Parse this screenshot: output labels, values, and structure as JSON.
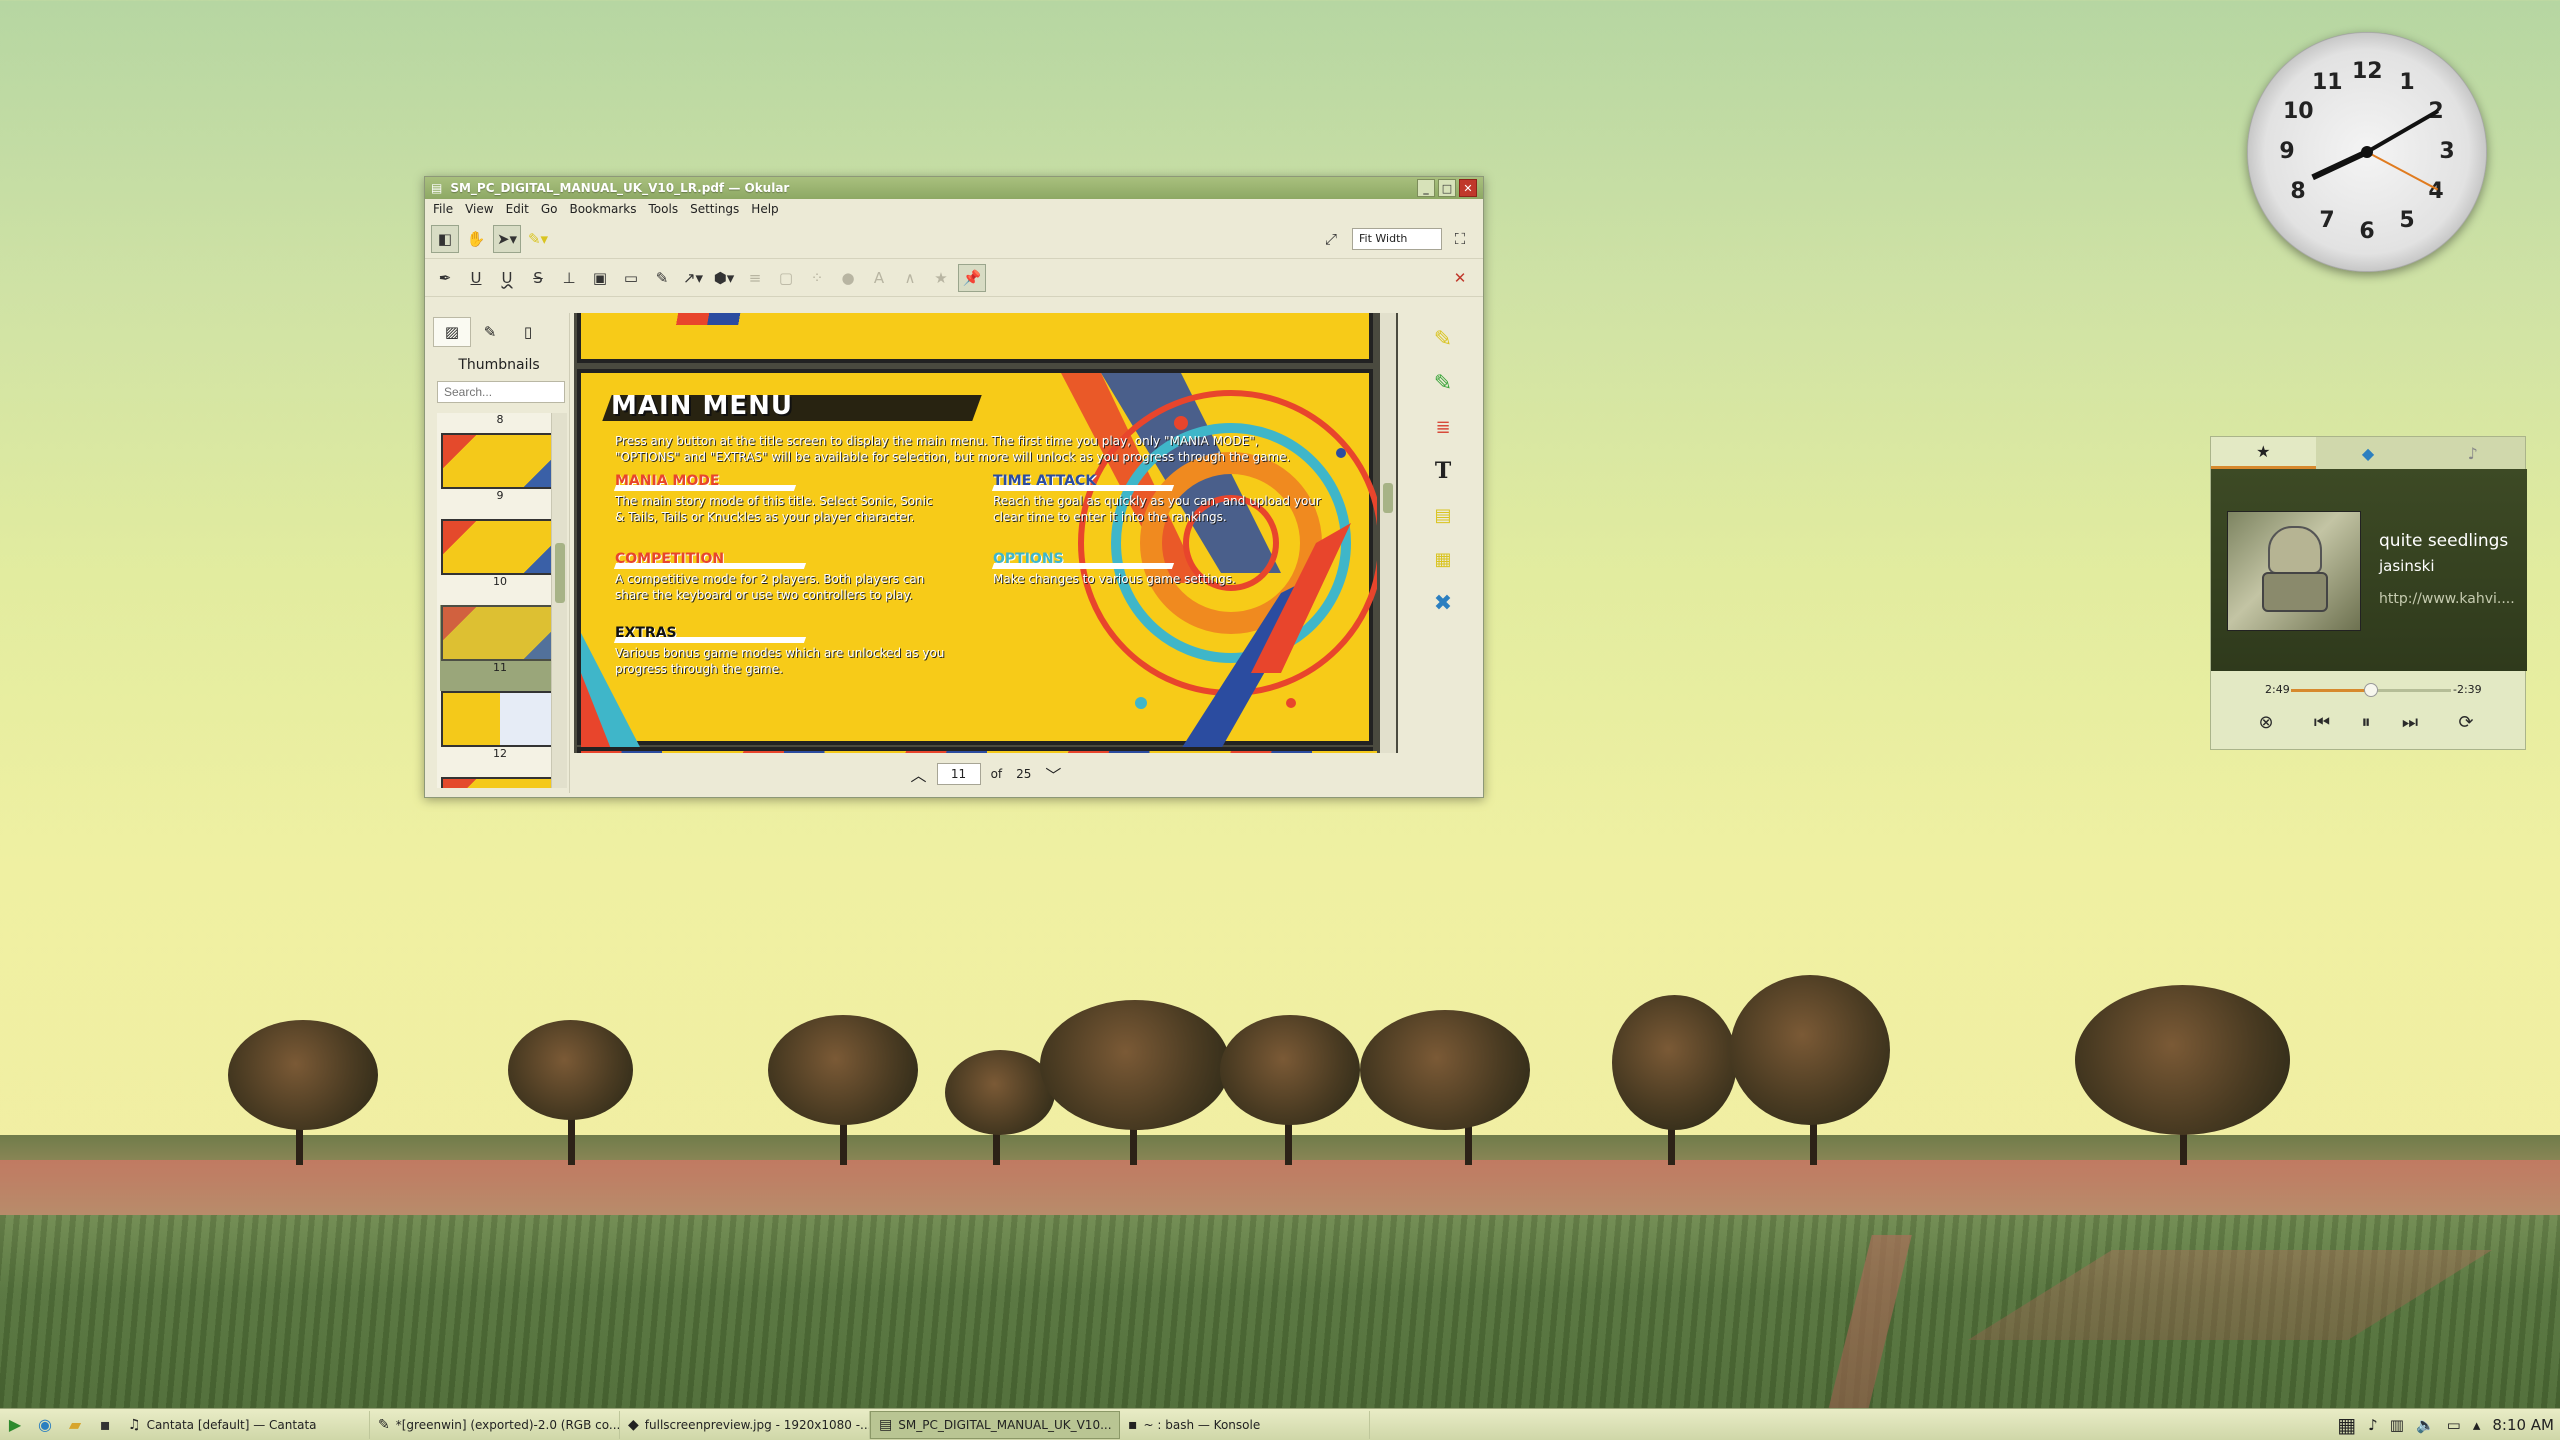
{
  "window": {
    "title": "SM_PC_DIGITAL_MANUAL_UK_V10_LR.pdf — Okular",
    "controls": {
      "minimize": "_",
      "maximize": "□",
      "close": "✕"
    },
    "menu": [
      "File",
      "View",
      "Edit",
      "Go",
      "Bookmarks",
      "Tools",
      "Settings",
      "Help"
    ],
    "zoom_value": "Fit Width",
    "sidebar": {
      "title": "Thumbnails",
      "search_placeholder": "Search...",
      "thumbnails": [
        {
          "label": "8",
          "selected": false
        },
        {
          "label": "9",
          "selected": false
        },
        {
          "label": "10",
          "selected": false
        },
        {
          "label": "11",
          "selected": true
        },
        {
          "label": "12",
          "selected": false
        }
      ]
    },
    "page_nav": {
      "current": "11",
      "of_label": "of",
      "total": "25"
    }
  },
  "document": {
    "heading": "MAIN MENU",
    "intro": "Press any button at the title screen to display the main menu. The first time you play, only \"MANIA MODE\", \"OPTIONS\" and \"EXTRAS\" will be available for selection, but more will unlock as you progress through the game.",
    "sections": [
      {
        "title": "MANIA MODE",
        "body": "The main story mode of this title. Select Sonic, Sonic & Tails, Tails or Knuckles as your player character.",
        "color": "#e8452c"
      },
      {
        "title": "TIME ATTACK",
        "body": "Reach the goal as quickly as you can, and upload your clear time to enter it into the rankings.",
        "color": "#2b4ca0"
      },
      {
        "title": "COMPETITION",
        "body": "A competitive mode for 2 players. Both players can share the keyboard or use two controllers to play.",
        "color": "#e8452c"
      },
      {
        "title": "OPTIONS",
        "body": "Make changes to various game settings.",
        "color": "#3fb6c9"
      },
      {
        "title": "EXTRAS",
        "body": "Various bonus game modes which are unlocked as you progress through the game.",
        "color": "#111111"
      }
    ]
  },
  "clock_widget": {
    "numbers": [
      "12",
      "1",
      "2",
      "3",
      "4",
      "5",
      "6",
      "7",
      "8",
      "9",
      "10",
      "11"
    ]
  },
  "player": {
    "track": "quite seedlings",
    "artist": "jasinski",
    "url": "http://www.kahvi....",
    "elapsed": "2:49",
    "remaining": "-2:39",
    "progress": 0.5
  },
  "taskbar": {
    "tasks": [
      {
        "label": "Cantata [default] — Cantata",
        "icon": "music-icon",
        "active": false
      },
      {
        "label": "*[greenwin] (exported)-2.0 (RGB co...",
        "icon": "gimp-icon",
        "active": false
      },
      {
        "label": "fullscreenpreview.jpg - 1920x1080 -...",
        "icon": "image-icon",
        "active": false
      },
      {
        "label": "SM_PC_DIGITAL_MANUAL_UK_V10...",
        "icon": "document-icon",
        "active": true
      },
      {
        "label": "~ : bash — Konsole",
        "icon": "terminal-icon",
        "active": false
      }
    ],
    "time": "8:10 AM"
  }
}
